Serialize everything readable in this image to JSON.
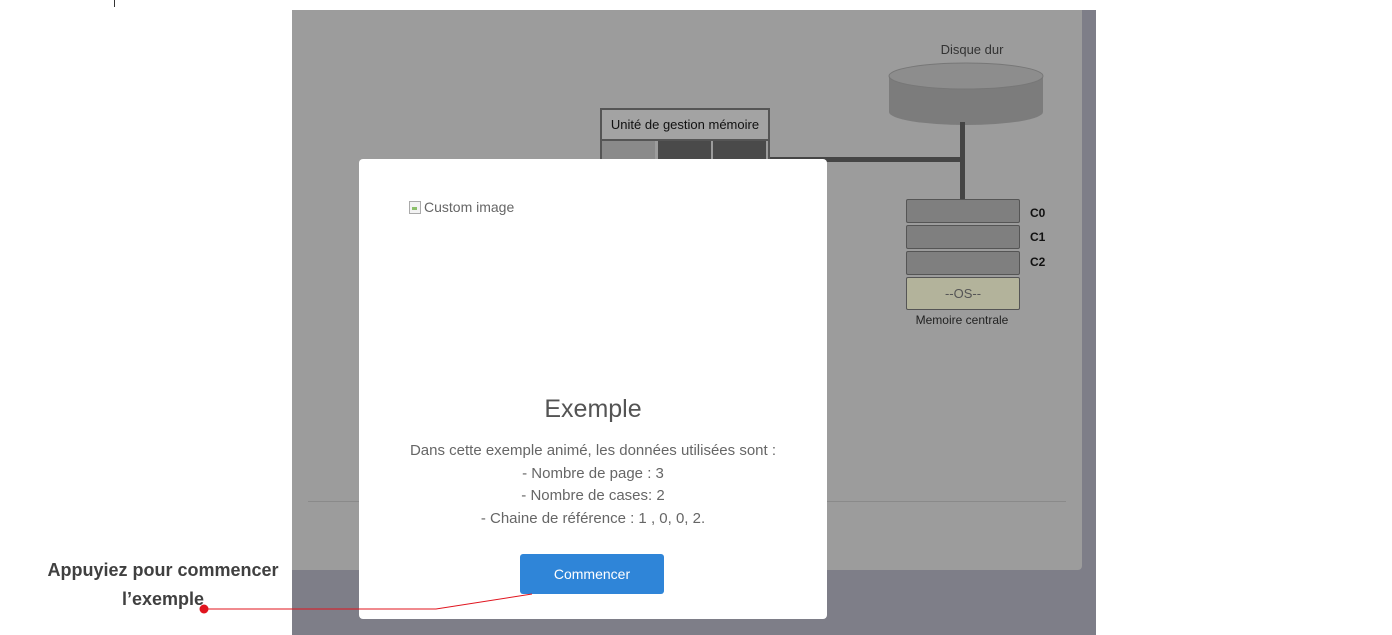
{
  "diagram": {
    "disk_label": "Disque dur",
    "mmu_title": "Unité de gestion mémoire",
    "frames": [
      {
        "label": "C0",
        "content": ""
      },
      {
        "label": "C1",
        "content": ""
      },
      {
        "label": "C2",
        "content": ""
      }
    ],
    "os_frame": "--OS--",
    "memory_label": "Memoire centrale"
  },
  "modal": {
    "image_alt": "Custom image",
    "title": "Exemple",
    "lines": [
      "Dans cette exemple animé, les données utilisées sont :",
      "- Nombre de page : 3",
      "- Nombre de cases: 2",
      "- Chaine de référence : 1 , 0, 0, 2."
    ],
    "start_button": "Commencer",
    "button_color": "#2f85d8"
  },
  "annotation": {
    "line1": "Appuyiez pour commencer",
    "line2": "l’exemple",
    "pointer_color": "#e0141e"
  }
}
